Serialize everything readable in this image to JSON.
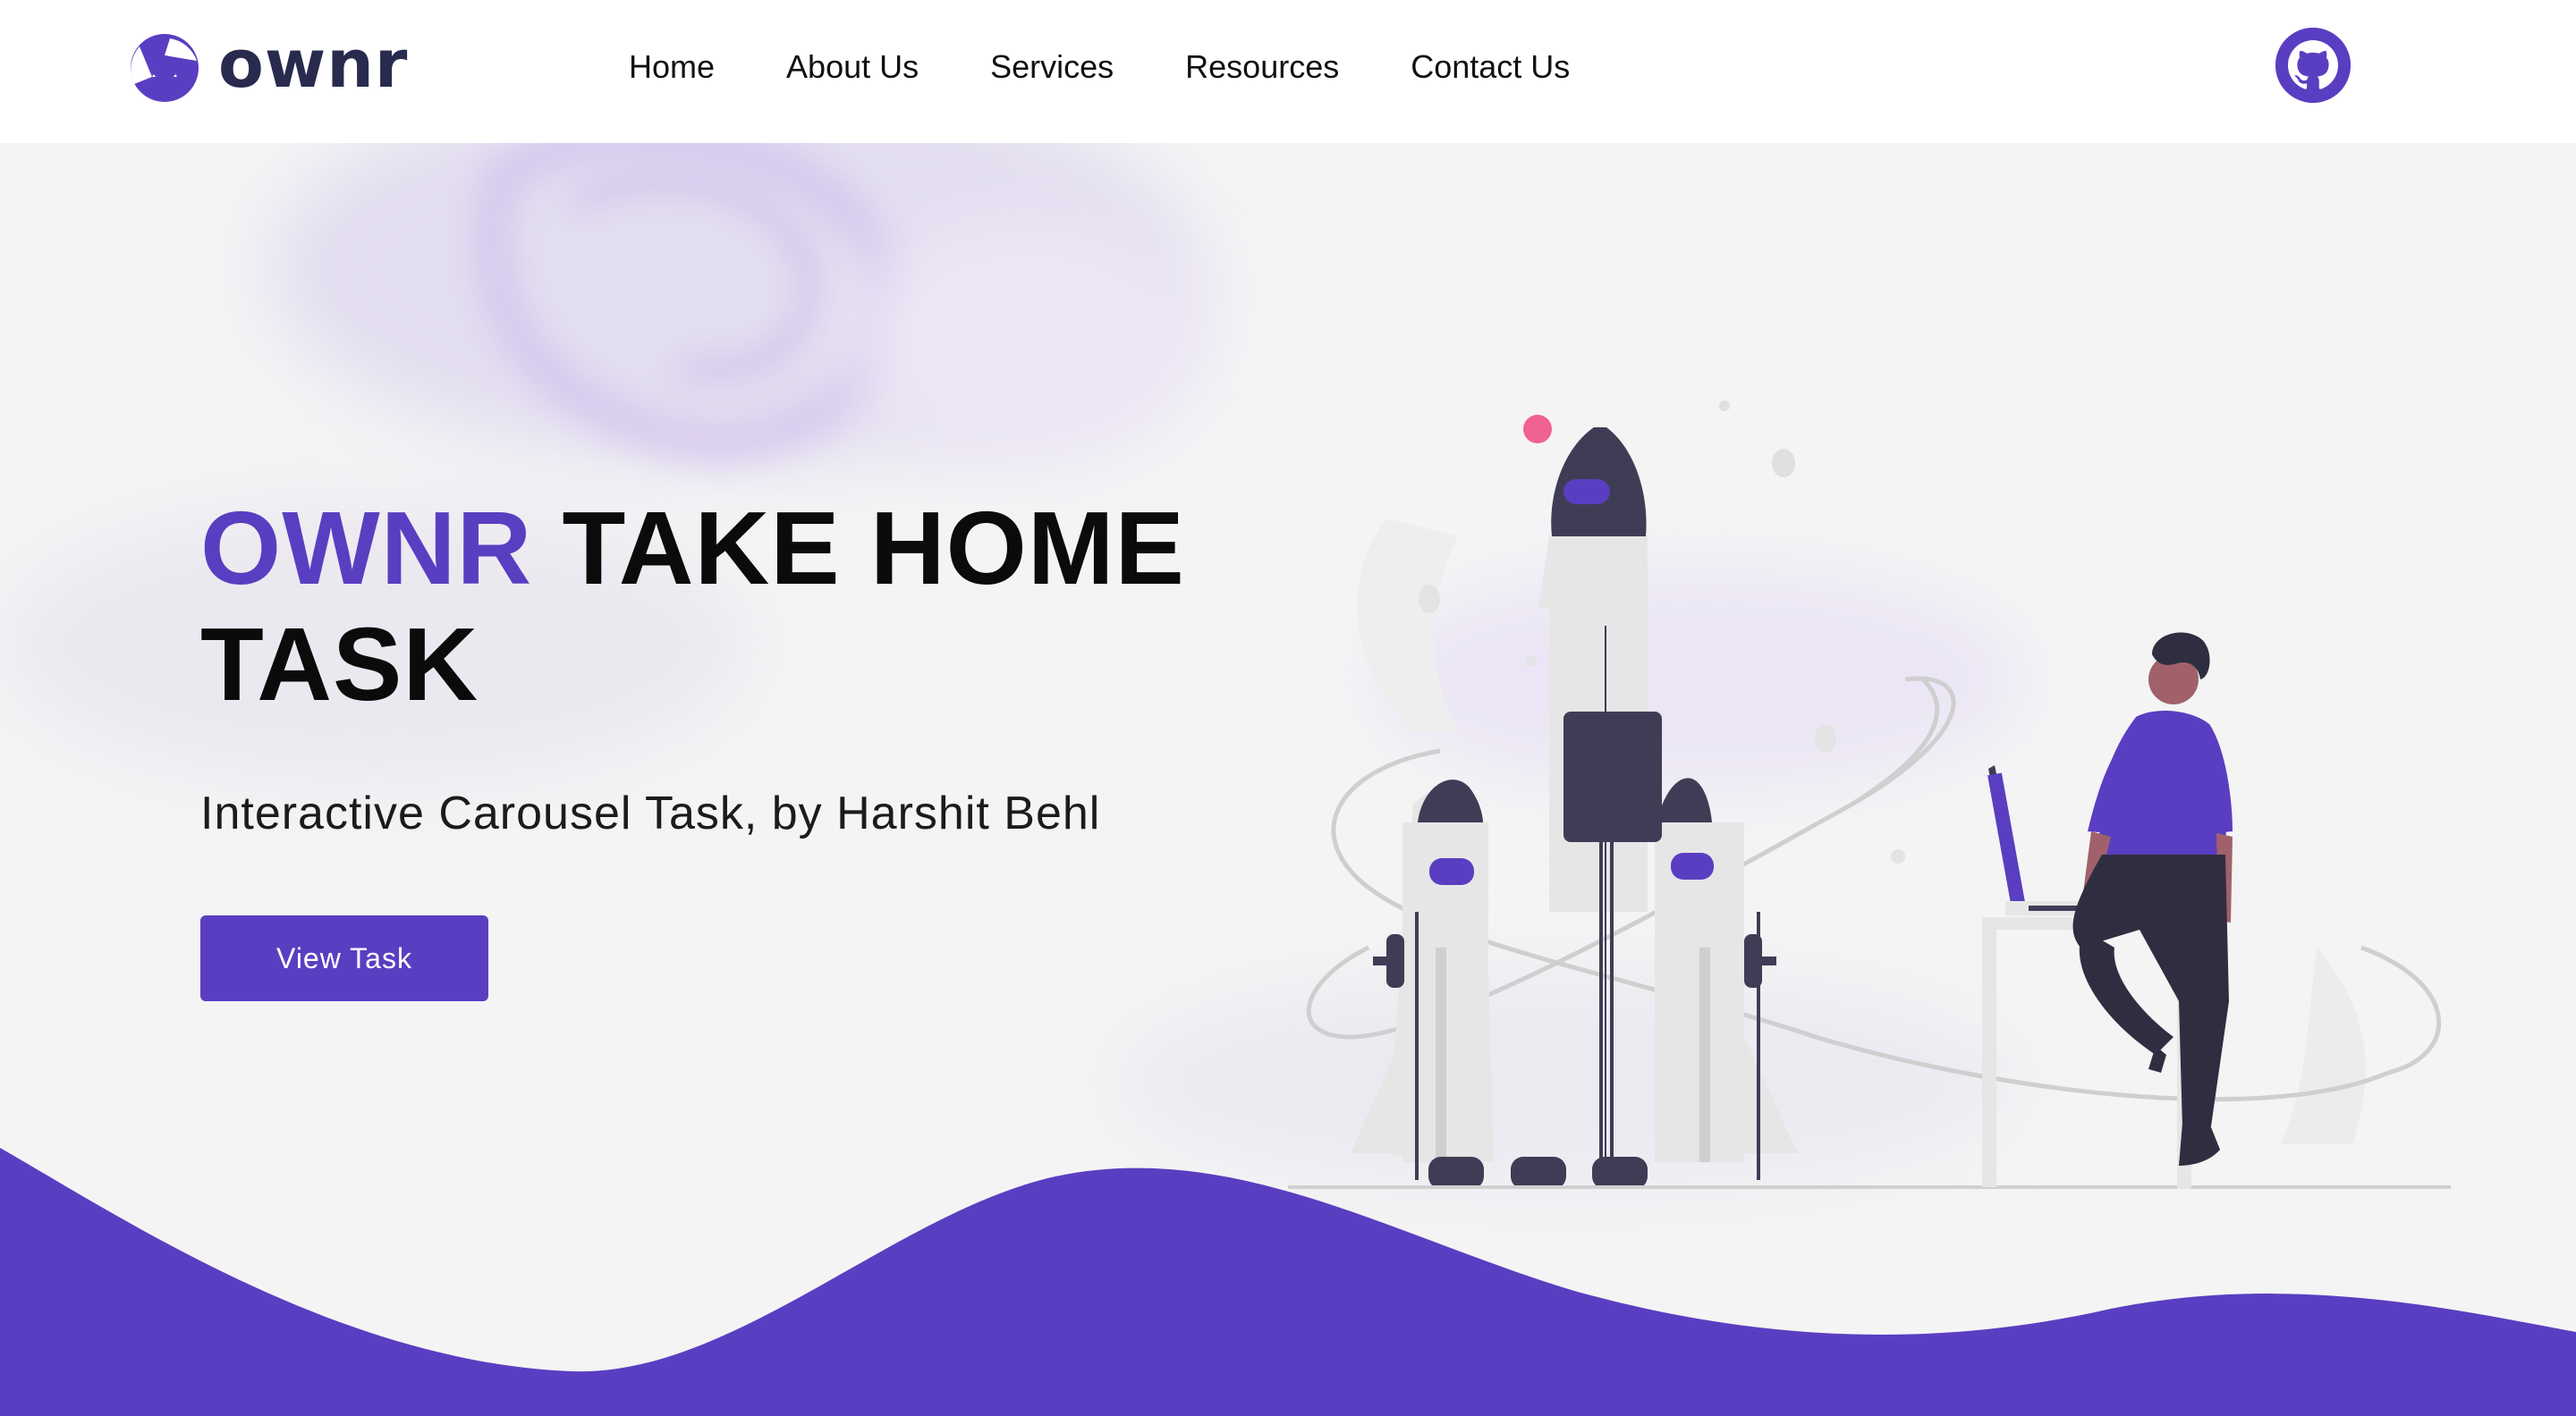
{
  "brand": {
    "name": "ownr",
    "color": "#5a3ec1",
    "logo_icon": "ownr-logo-icon"
  },
  "nav": {
    "items": [
      {
        "label": "Home"
      },
      {
        "label": "About Us"
      },
      {
        "label": "Services"
      },
      {
        "label": "Resources"
      },
      {
        "label": "Contact Us"
      }
    ],
    "github_icon": "github-icon"
  },
  "hero": {
    "title_brand": "OWNR",
    "title_rest": "TAKE HOME TASK",
    "subtitle": "Interactive Carousel Task, by Harshit Behl",
    "cta_label": "View Task",
    "illustration": "rocket-launch-illustration"
  },
  "colors": {
    "accent": "#5a3ec1",
    "dark": "#3f3d56",
    "heading": "#0b0b0b",
    "background": "#f4f4f5"
  }
}
